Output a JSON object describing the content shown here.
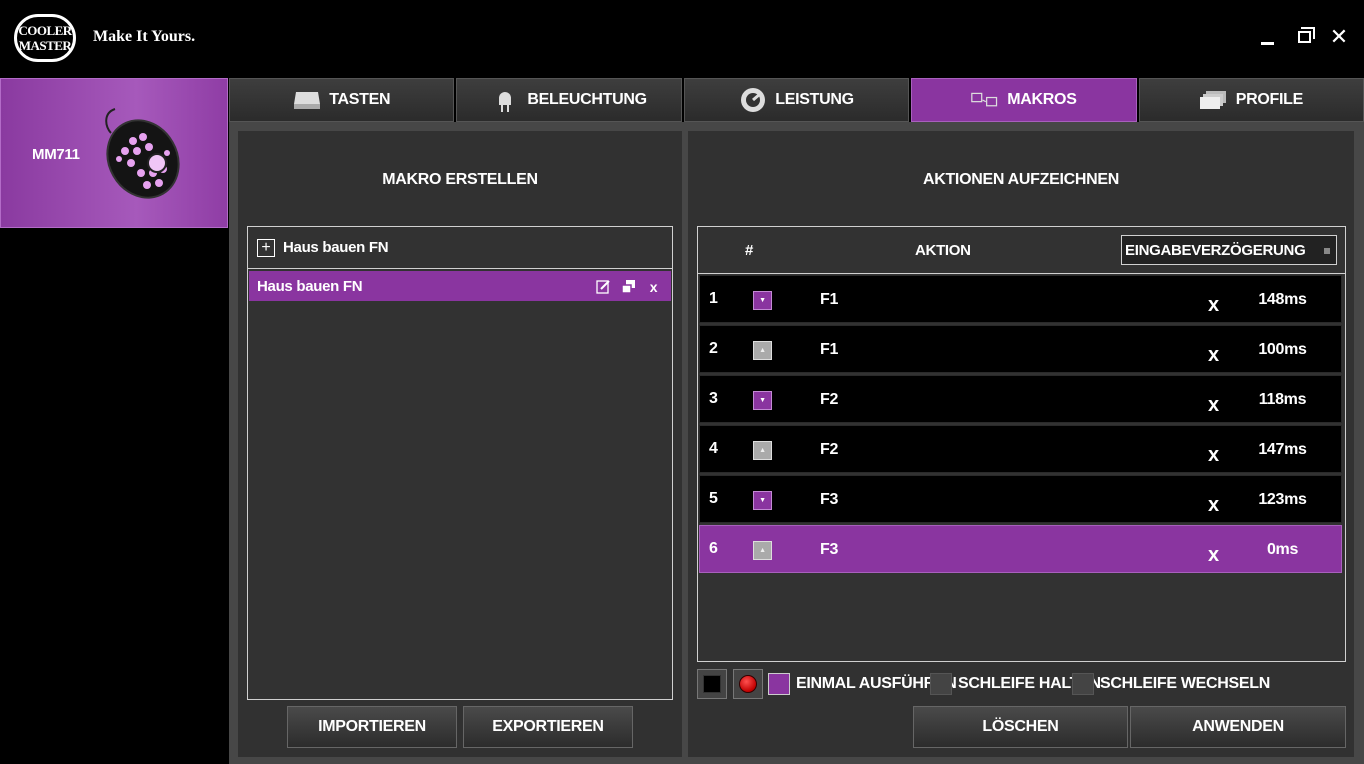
{
  "header": {
    "logo_line1": "COOLER",
    "logo_line2": "MASTER",
    "tagline": "Make It Yours.",
    "close_glyph": "✕"
  },
  "device": {
    "name": "MM711"
  },
  "tabs": [
    {
      "label": "TASTEN",
      "icon": "keycap-icon"
    },
    {
      "label": "BELEUCHTUNG",
      "icon": "light-bulb-icon"
    },
    {
      "label": "LEISTUNG",
      "icon": "gauge-icon"
    },
    {
      "label": "MAKROS",
      "icon": "macro-keys-icon",
      "active": true
    },
    {
      "label": "PROFILE",
      "icon": "profiles-icon"
    }
  ],
  "left_panel": {
    "title": "MAKRO ERSTELLEN",
    "add_glyph": "+",
    "group_label": "Haus bauen FN",
    "macro_item": "Haus bauen FN",
    "delete_glyph": "x",
    "import_label": "IMPORTIEREN",
    "export_label": "EXPORTIEREN"
  },
  "right_panel": {
    "title": "AKTIONEN AUFZEICHNEN",
    "col_num": "#",
    "col_action": "AKTION",
    "delay_select": "EINGABEVERZÖGERUNG",
    "rows": [
      {
        "num": "1",
        "event": "down",
        "glyph": "▼",
        "key": "F1",
        "del": "x",
        "delay": "148ms"
      },
      {
        "num": "2",
        "event": "up",
        "glyph": "▲",
        "key": "F1",
        "del": "x",
        "delay": "100ms"
      },
      {
        "num": "3",
        "event": "down",
        "glyph": "▼",
        "key": "F2",
        "del": "x",
        "delay": "118ms"
      },
      {
        "num": "4",
        "event": "up",
        "glyph": "▲",
        "key": "F2",
        "del": "x",
        "delay": "147ms"
      },
      {
        "num": "5",
        "event": "down",
        "glyph": "▼",
        "key": "F3",
        "del": "x",
        "delay": "123ms"
      },
      {
        "num": "6",
        "event": "up",
        "glyph": "▲",
        "key": "F3",
        "del": "x",
        "delay": "0ms",
        "selected": true
      }
    ],
    "options": [
      {
        "label": "EINMAL AUSFÜHREN",
        "checked": true
      },
      {
        "label": "SCHLEIFE HALTEN",
        "checked": false
      },
      {
        "label": "SCHLEIFE WECHSELN",
        "checked": false
      }
    ],
    "clear_label": "LÖSCHEN",
    "apply_label": "ANWENDEN"
  },
  "colors": {
    "accent": "#8a35a0",
    "panel": "#313131",
    "background": "#000000"
  }
}
